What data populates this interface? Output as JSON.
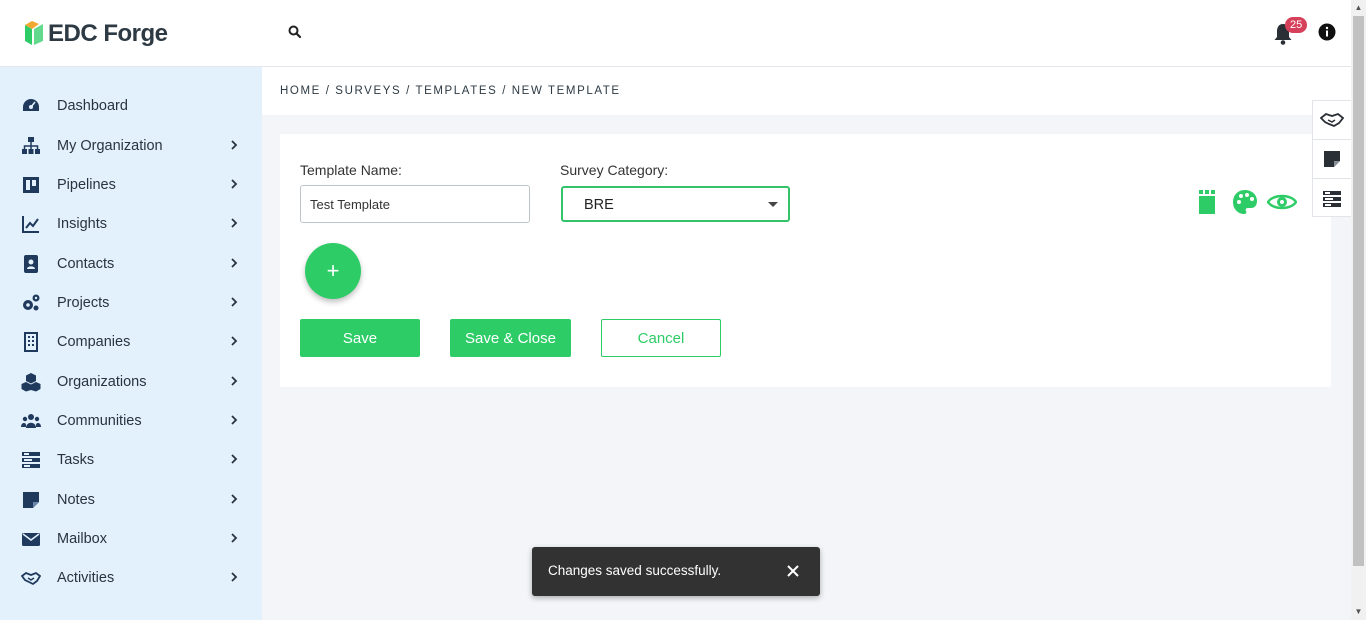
{
  "app": {
    "logo_text": "EDC Forge",
    "brand_color": "#2ecc67",
    "notification_count": "25"
  },
  "sidebar": {
    "items": [
      {
        "label": "Dashboard",
        "icon": "dashboard-icon",
        "has_chevron": false
      },
      {
        "label": "My Organization",
        "icon": "org-chart-icon",
        "has_chevron": true
      },
      {
        "label": "Pipelines",
        "icon": "pipeline-icon",
        "has_chevron": true
      },
      {
        "label": "Insights",
        "icon": "chart-line-icon",
        "has_chevron": true
      },
      {
        "label": "Contacts",
        "icon": "contact-card-icon",
        "has_chevron": true
      },
      {
        "label": "Projects",
        "icon": "cogs-icon",
        "has_chevron": true
      },
      {
        "label": "Companies",
        "icon": "building-icon",
        "has_chevron": true
      },
      {
        "label": "Organizations",
        "icon": "cubes-icon",
        "has_chevron": true
      },
      {
        "label": "Communities",
        "icon": "users-icon",
        "has_chevron": true
      },
      {
        "label": "Tasks",
        "icon": "tasks-icon",
        "has_chevron": true
      },
      {
        "label": "Notes",
        "icon": "note-icon",
        "has_chevron": true
      },
      {
        "label": "Mailbox",
        "icon": "envelope-icon",
        "has_chevron": true
      },
      {
        "label": "Activities",
        "icon": "handshake-icon",
        "has_chevron": true
      }
    ]
  },
  "breadcrumb": {
    "home": "HOME",
    "surveys": "SURVEYS",
    "templates": "TEMPLATES",
    "current": "NEW TEMPLATE",
    "separator": "/"
  },
  "form": {
    "template_name_label": "Template Name:",
    "template_name_value": "Test Template",
    "survey_category_label": "Survey Category:",
    "survey_category_value": "BRE",
    "add_label": "+",
    "save_label": "Save",
    "save_close_label": "Save & Close",
    "cancel_label": "Cancel"
  },
  "toast": {
    "message": "Changes saved successfully."
  }
}
